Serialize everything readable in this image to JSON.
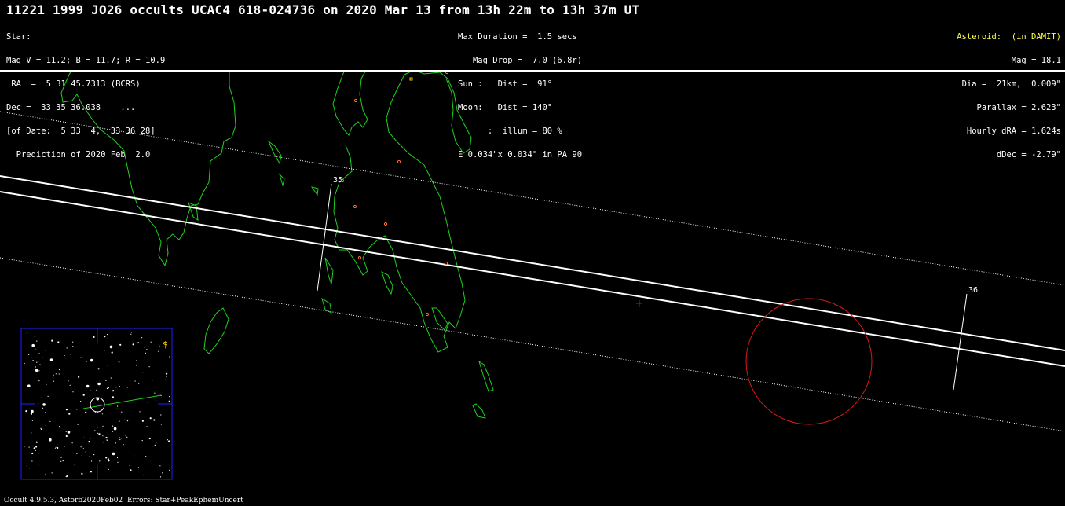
{
  "title": "11221 1999 JO26 occults UCAC4 618-024736 on 2020 Mar 13 from 13h 22m to 13h 37m UT",
  "star_info": [
    "Star:",
    "Mag V = 11.2; B = 11.7; R = 10.9",
    " RA  =  5 31 45.7313 (BCRS)",
    "Dec =  33 35 36.038    ...",
    "[of Date:  5 33  4,  33 36 28]",
    "  Prediction of 2020 Feb  2.0"
  ],
  "event_info": [
    "Max Duration =  1.5 secs",
    "   Mag Drop =  7.0 (6.8r)",
    "Sun :   Dist =  91°",
    "Moon:   Dist = 140°",
    "      :  illum = 80 %",
    "E 0.034\"x 0.034\" in PA 90"
  ],
  "asteroid_info": {
    "header": "Asteroid:  (in DAMIT)",
    "lines": [
      "Mag = 18.1",
      "Dia =  21km,  0.009\"",
      "Parallax = 2.623\"",
      "Hourly dRA = 1.624s",
      "dDec = -2.79\""
    ]
  },
  "map": {
    "time_labels": [
      "35",
      "36"
    ],
    "finder_label": "$",
    "colors": {
      "coastline": "#1fd11f",
      "path": "#ffffff",
      "uncertainty": "#ffffff",
      "circle": "#e01818",
      "city": "#ff7030",
      "finder_border": "#2020ff",
      "center_cross": "#3030ff"
    }
  },
  "footer": "Occult 4.9.5.3, Astorb2020Feb02  Errors: Star+PeakEphemUncert"
}
